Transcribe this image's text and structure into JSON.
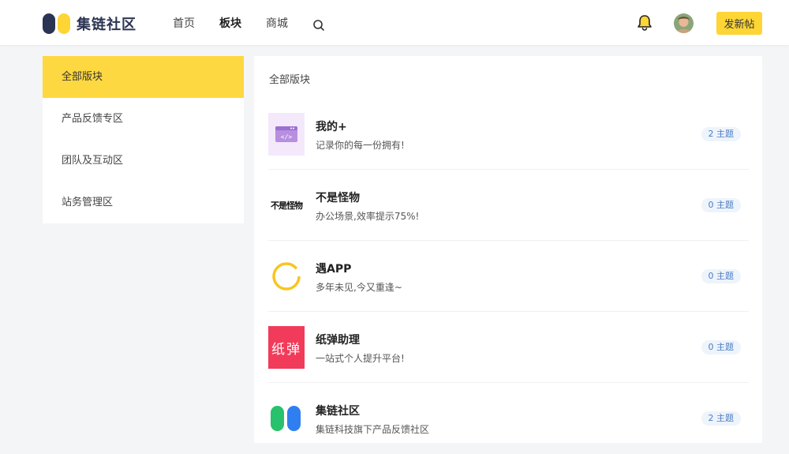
{
  "header": {
    "logo_text": "集链社区",
    "nav": [
      {
        "label": "首页"
      },
      {
        "label": "板块"
      },
      {
        "label": "商城"
      }
    ],
    "post_button": "发新帖",
    "icons": {
      "search": "search-icon",
      "bell": "bell-icon"
    }
  },
  "sidebar": {
    "items": [
      {
        "label": "全部版块"
      },
      {
        "label": "产品反馈专区"
      },
      {
        "label": "团队及互动区"
      },
      {
        "label": "站务管理区"
      }
    ]
  },
  "main": {
    "title": "全部版块",
    "boards": [
      {
        "name": "我的+",
        "desc": "记录你的每一份拥有!",
        "count": "2 主题",
        "icon_text": "</>"
      },
      {
        "name": "不是怪物",
        "desc": "办公场景,效率提示75%!",
        "count": "0 主题",
        "icon_text": "不是怪物"
      },
      {
        "name": "遇APP",
        "desc": "多年未见,今又重逢~",
        "count": "0 主题"
      },
      {
        "name": "纸弹助理",
        "desc": "一站式个人提升平台!",
        "count": "0 主题",
        "icon_text": "纸弹"
      },
      {
        "name": "集链社区",
        "desc": "集链科技旗下产品反馈社区",
        "count": "2 主题"
      }
    ]
  },
  "colors": {
    "accent": "#fdd535",
    "logo_dark": "#2b3452",
    "logo_yellow": "#fdd535",
    "count_text": "#4a7cc4"
  }
}
